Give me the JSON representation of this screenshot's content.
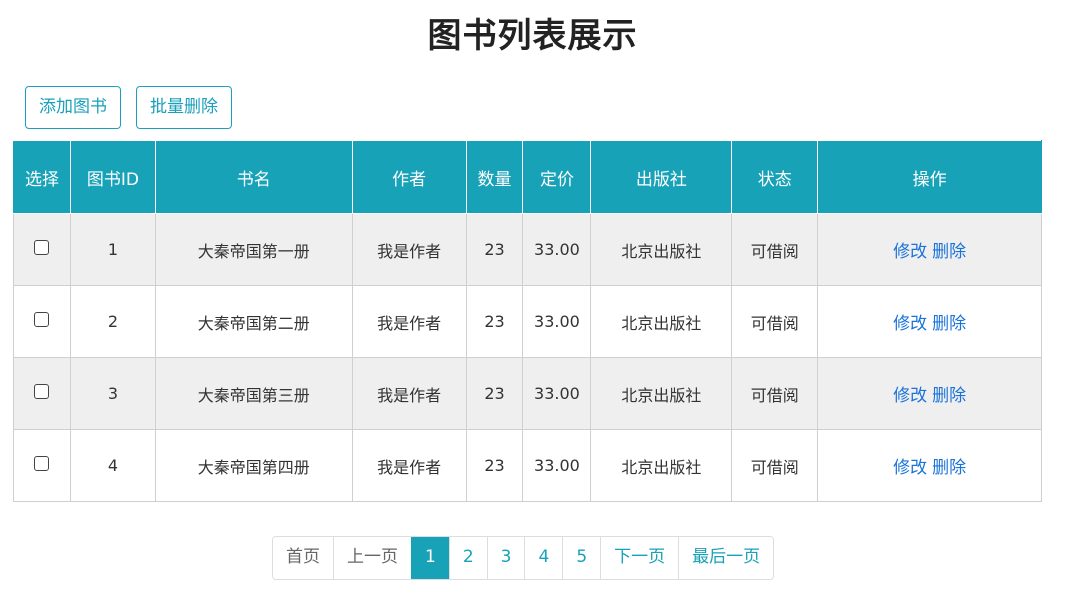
{
  "title": "图书列表展示",
  "toolbar": {
    "add_label": "添加图书",
    "batch_delete_label": "批量删除"
  },
  "table": {
    "headers": [
      "选择",
      "图书ID",
      "书名",
      "作者",
      "数量",
      "定价",
      "出版社",
      "状态",
      "操作"
    ],
    "rows": [
      {
        "id": "1",
        "name": "大秦帝国第一册",
        "author": "我是作者",
        "count": "23",
        "price": "33.00",
        "publisher": "北京出版社",
        "status": "可借阅"
      },
      {
        "id": "2",
        "name": "大秦帝国第二册",
        "author": "我是作者",
        "count": "23",
        "price": "33.00",
        "publisher": "北京出版社",
        "status": "可借阅"
      },
      {
        "id": "3",
        "name": "大秦帝国第三册",
        "author": "我是作者",
        "count": "23",
        "price": "33.00",
        "publisher": "北京出版社",
        "status": "可借阅"
      },
      {
        "id": "4",
        "name": "大秦帝国第四册",
        "author": "我是作者",
        "count": "23",
        "price": "33.00",
        "publisher": "北京出版社",
        "status": "可借阅"
      }
    ],
    "edit_label": "修改",
    "delete_label": "删除"
  },
  "pagination": {
    "first": "首页",
    "prev": "上一页",
    "pages": [
      "1",
      "2",
      "3",
      "4",
      "5"
    ],
    "current": "1",
    "next": "下一页",
    "last": "最后一页"
  },
  "colors": {
    "accent": "#17a2b8",
    "link": "#1a73d9",
    "row_alt": "#efefef"
  }
}
